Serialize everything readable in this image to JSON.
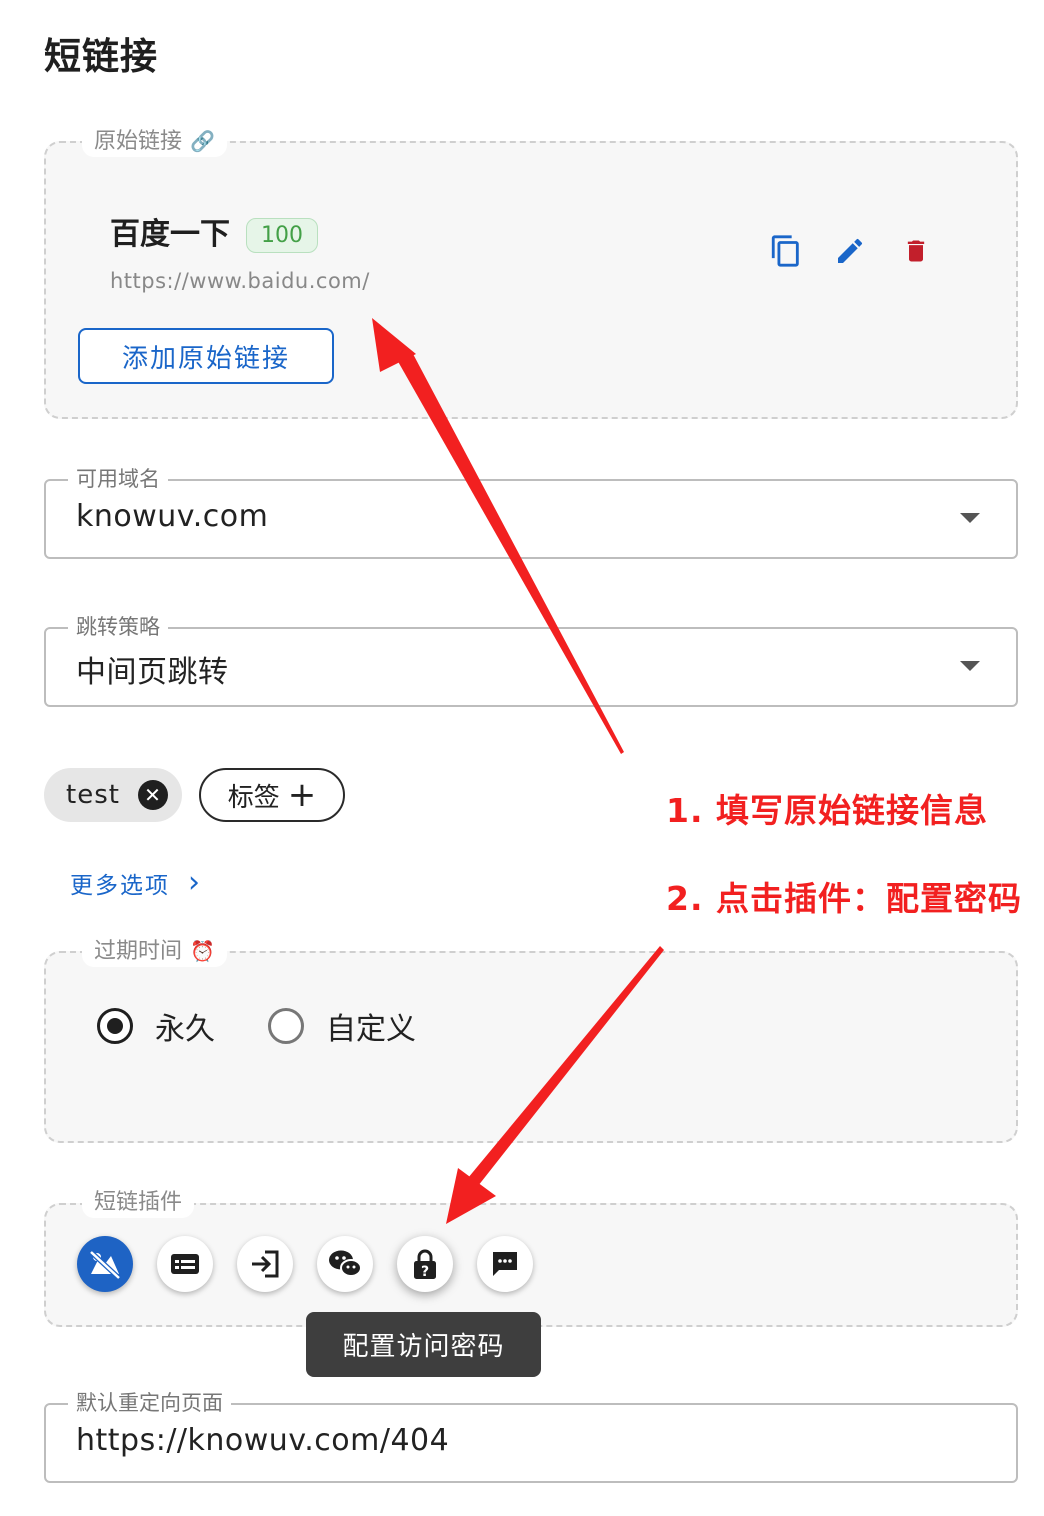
{
  "page": {
    "title": "短链接"
  },
  "original_link": {
    "legend": "原始链接",
    "legend_icon": "🔗",
    "item": {
      "title": "百度一下",
      "badge": "100",
      "url": "https://www.baidu.com/"
    },
    "icons": [
      "copy-icon",
      "edit-icon",
      "delete-icon"
    ],
    "add_button": "添加原始链接"
  },
  "domain_field": {
    "label": "可用域名",
    "value": "knowuv.com"
  },
  "redirect_field": {
    "label": "跳转策略",
    "value": "中间页跳转"
  },
  "tags": {
    "chips": [
      "test"
    ],
    "add_label": "标签",
    "add_icon": "+"
  },
  "more_options": {
    "label": "更多选项",
    "chevron": "›"
  },
  "expiration": {
    "legend": "过期时间",
    "legend_icon": "⏰",
    "options": [
      {
        "label": "永久",
        "selected": true
      },
      {
        "label": "自定义",
        "selected": false
      }
    ]
  },
  "plugins": {
    "legend": "短链插件",
    "icons": [
      "no-ads-icon",
      "card-icon",
      "login-icon",
      "wechat-icon",
      "lock-question-icon",
      "message-icon"
    ],
    "tooltip": "配置访问密码"
  },
  "default_redirect": {
    "label": "默认重定向页面",
    "value": "https://knowuv.com/404"
  },
  "annotations": {
    "step1": "1. 填写原始链接信息",
    "step2": "2. 点击插件：配置密码",
    "color": "#f22020"
  },
  "colors": {
    "primary": "#1a66c9",
    "delete": "#c21f2b",
    "badge_green": "#43a047"
  }
}
